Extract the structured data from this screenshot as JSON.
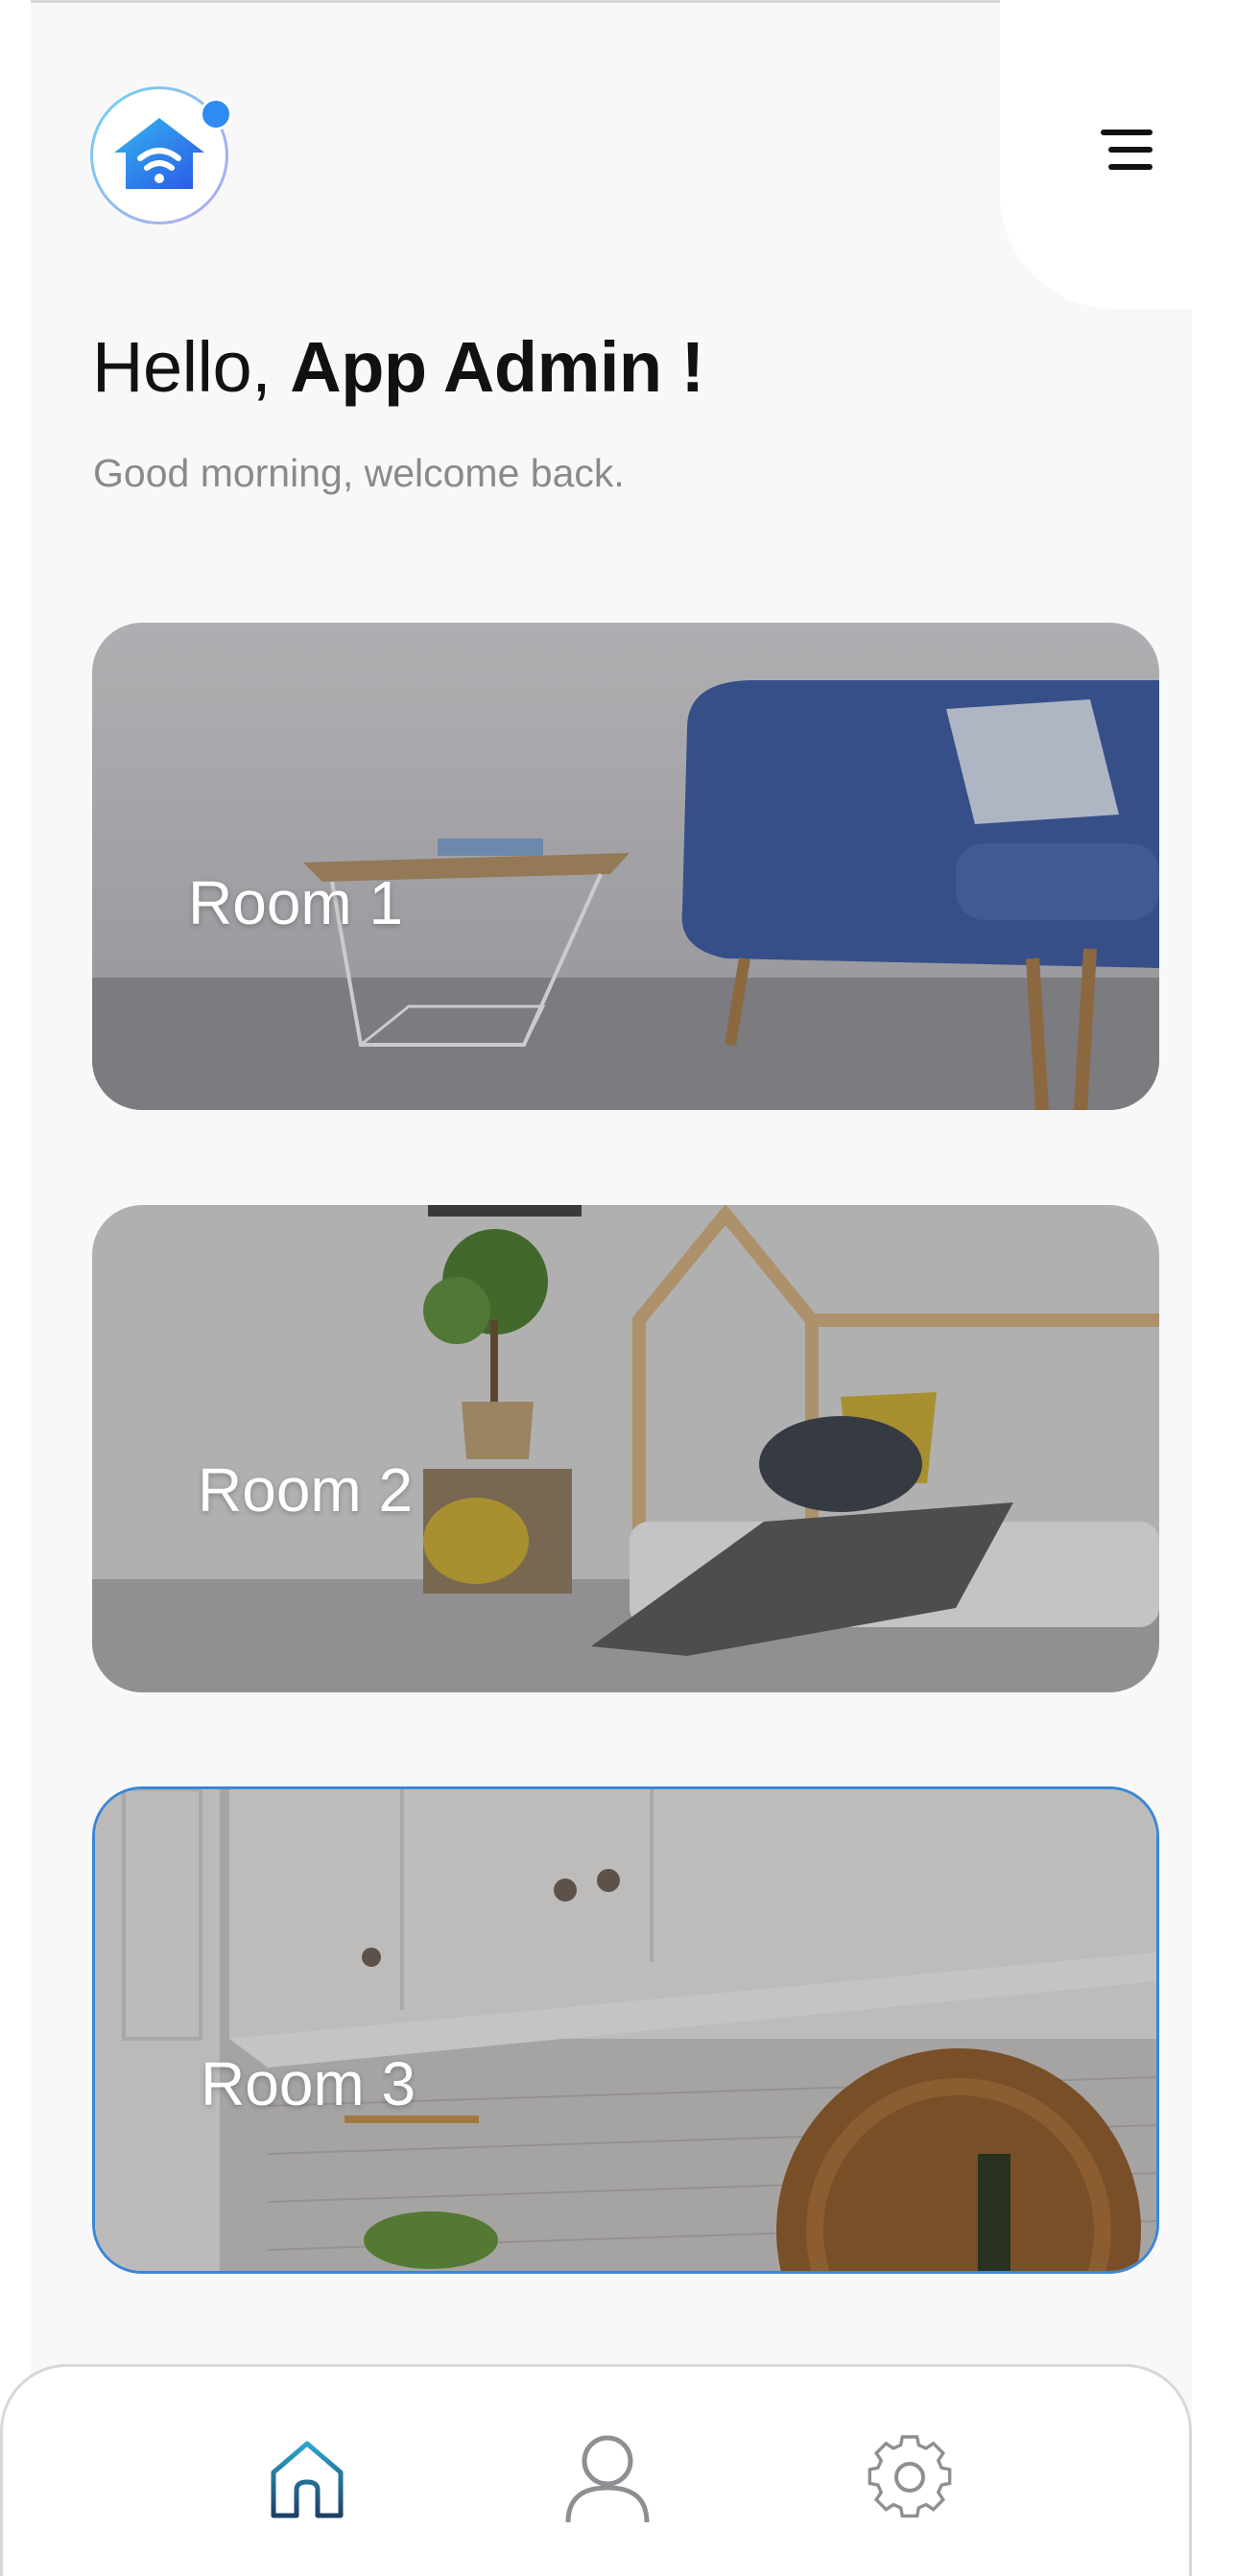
{
  "header": {
    "logo_icon": "smart-home-wifi-icon",
    "menu_icon": "menu-lines-icon",
    "greeting_prefix": "Hello, ",
    "user_name": "App Admin !",
    "subtitle": "Good morning, welcome back."
  },
  "rooms": [
    {
      "label": "Room 1",
      "image": "living-room-blue-sofa"
    },
    {
      "label": "Room 2",
      "image": "kids-bedroom"
    },
    {
      "label": "Room 3",
      "image": "kitchen-cabinets",
      "selected": true
    }
  ],
  "bottom_nav": {
    "items": [
      {
        "icon": "home-icon",
        "active": true
      },
      {
        "icon": "user-icon",
        "active": false
      },
      {
        "icon": "gear-icon",
        "active": false
      }
    ]
  },
  "colors": {
    "background": "#f8f8f9",
    "accent": "#2f8af2",
    "selected_border": "#3a86d8",
    "active_icon": "#1f6f9a",
    "inactive_icon": "#8f8f93"
  }
}
